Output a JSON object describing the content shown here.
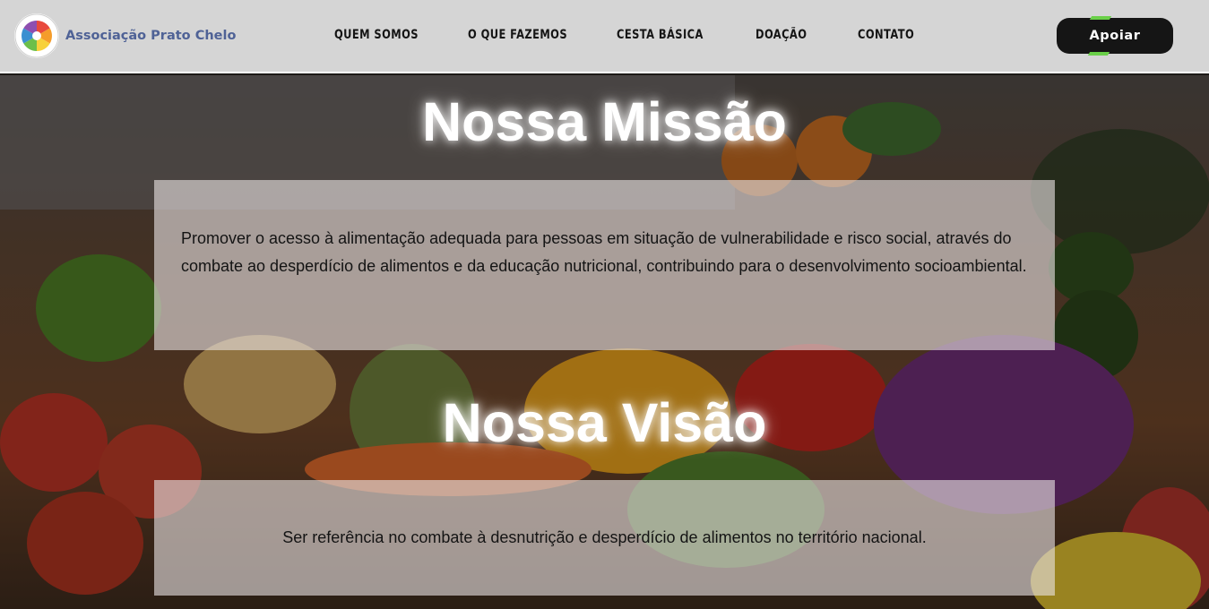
{
  "header": {
    "logo_text": "Associação Prato Chelo",
    "nav": [
      {
        "label": "QUEM SOMOS"
      },
      {
        "label": "O QUE FAZEMOS"
      },
      {
        "label": "CESTA BÁSICA"
      },
      {
        "label": "DOAÇÃO"
      },
      {
        "label": "CONTATO"
      }
    ],
    "cta_label": "Apoiar"
  },
  "mission": {
    "title": "Nossa Missão",
    "text": "Promover o acesso à alimentação adequada para pessoas em situação de vulnerabilidade e risco social, através do combate ao desperdício de alimentos e da educação nutricional, contribuindo para o desenvolvimento socioambiental."
  },
  "vision": {
    "title": "Nossa Visão",
    "text": "Ser referência no combate à desnutrição e desperdício de alimentos no território nacional."
  },
  "colors": {
    "header_bg": "#d5d5d5",
    "logo_text": "#4f6296",
    "button_bg": "#151515",
    "accent_green": "#6ad049"
  },
  "icons": {
    "logo": "colorful-wheel-logo-icon"
  }
}
